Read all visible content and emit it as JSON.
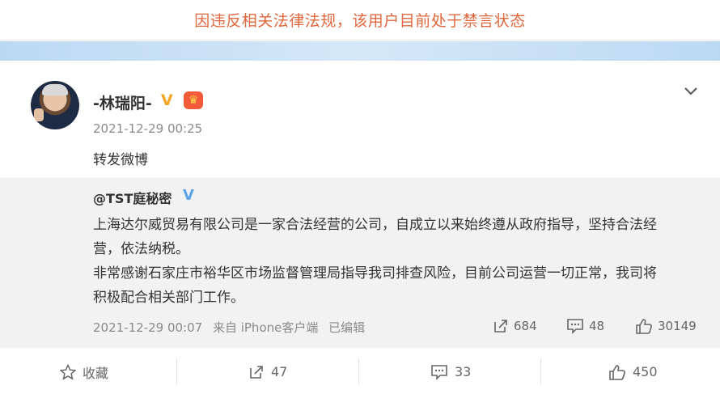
{
  "banner": {
    "text": "因违反相关法律法规，该用户目前处于禁言状态"
  },
  "post": {
    "username": "-林瑞阳-",
    "v_badge": "V",
    "crown_badge": "♛",
    "timestamp": "2021-12-29 00:25",
    "text": "转发微博"
  },
  "original": {
    "username": "@TST庭秘密",
    "v_badge": "V",
    "body_lines": [
      "上海达尔威贸易有限公司是一家合法经营的公司，自成立以来始终遵从政府指导，坚持合法经",
      "营，依法纳税。",
      "非常感谢石家庄市裕华区市场监督管理局指导我司排查风险，目前公司运营一切正常，我司将",
      "积极配合相关部门工作。"
    ],
    "timestamp": "2021-12-29 00:07",
    "source": "来自 iPhone客户端",
    "edited": "已编辑",
    "reposts": "684",
    "comments": "48",
    "likes": "30149"
  },
  "footer": {
    "favorite_label": "收藏",
    "repost_count": "47",
    "comment_count": "33",
    "like_count": "450"
  },
  "colors": {
    "banner_text": "#e0683e",
    "v_gold": "#f5a623",
    "v_blue": "#5aa3e8",
    "repost_bg": "#f2f2f2"
  },
  "icons": {
    "expand": "chevron-down-icon",
    "repost": "share-icon",
    "comment": "comment-icon",
    "like": "thumb-up-icon",
    "favorite": "star-icon"
  }
}
